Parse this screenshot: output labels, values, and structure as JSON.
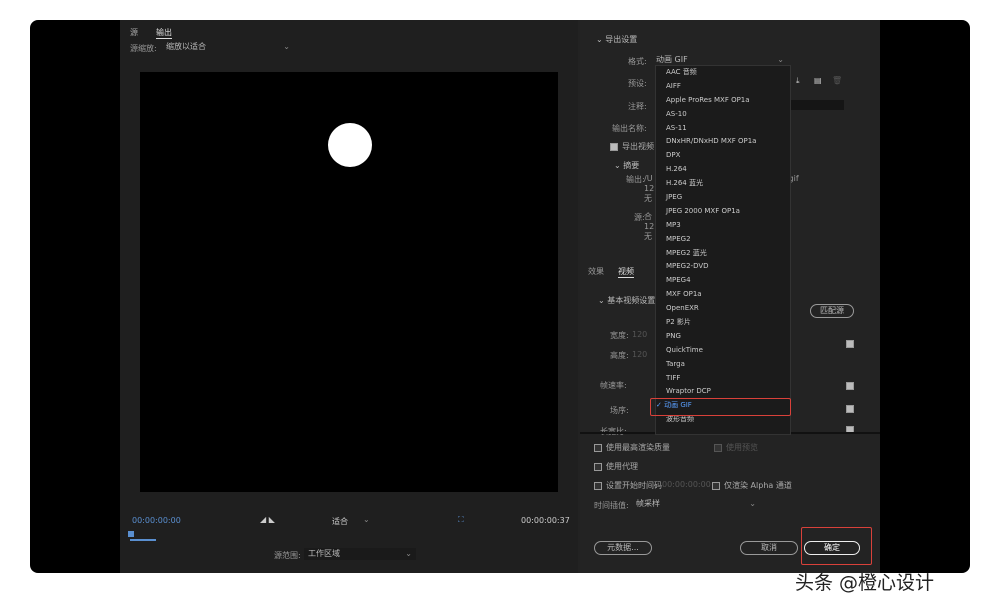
{
  "left": {
    "tabs": [
      "源",
      "输出"
    ],
    "active_tab": "输出",
    "source_scale_label": "源缩放:",
    "source_scale_value": "缩放以适合",
    "timecode_start": "00:00:00:00",
    "fit_value": "适合",
    "timecode_end": "00:00:00:37",
    "source_range_label": "源范围:",
    "source_range_value": "工作区域"
  },
  "right": {
    "export_settings": "导出设置",
    "format_label": "格式:",
    "format_value": "动画 GIF",
    "preset_label": "预设:",
    "comment_label": "注释:",
    "output_name_label": "输出名称:",
    "export_video": "导出视频",
    "summary": "摘要",
    "output_label": "输出:",
    "output_lines": [
      "/U",
      "12",
      "无"
    ],
    "output_suffix": ".gif",
    "source_label": "源:",
    "source_lines": [
      "合",
      "12",
      "无"
    ],
    "tabs": [
      "效果",
      "视频"
    ],
    "active_tab": "视频",
    "basic_video": "基本视频设置",
    "match_source": "匹配源",
    "width_label": "宽度:",
    "width_value": "120",
    "height_label": "高度:",
    "height_value": "120",
    "framerate_label": "帧速率:",
    "field_label": "场序:",
    "aspect_label": "长宽比:",
    "max_quality": "使用最高渲染质量",
    "use_preview": "使用预览",
    "use_proxy": "使用代理",
    "set_start_tc": "设置开始时间码",
    "start_tc_value": "00:00:00:00",
    "alpha_only": "仅渲染 Alpha 通道",
    "time_interp_label": "时间插值:",
    "time_interp_value": "帧采样",
    "metadata_button": "元数据...",
    "cancel_button": "取消",
    "ok_button": "确定"
  },
  "format_options": [
    "AAC 音频",
    "AIFF",
    "Apple ProRes MXF OP1a",
    "AS-10",
    "AS-11",
    "DNxHR/DNxHD MXF OP1a",
    "DPX",
    "H.264",
    "H.264 蓝光",
    "JPEG",
    "JPEG 2000 MXF OP1a",
    "MP3",
    "MPEG2",
    "MPEG2 蓝光",
    "MPEG2-DVD",
    "MPEG4",
    "MXF OP1a",
    "OpenEXR",
    "P2 影片",
    "PNG",
    "QuickTime",
    "Targa",
    "TIFF",
    "Wraptor DCP",
    "动画 GIF",
    "波形音频"
  ],
  "selected_format": "动画 GIF",
  "watermark": "头条 @橙心设计",
  "colors": {
    "accent": "#5aa0ff",
    "highlight": "#d9413a"
  }
}
